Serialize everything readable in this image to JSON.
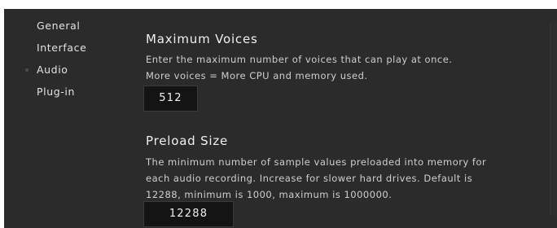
{
  "sidebar": {
    "items": [
      {
        "label": "General"
      },
      {
        "label": "Interface"
      },
      {
        "label": "Audio"
      },
      {
        "label": "Plug-in"
      }
    ]
  },
  "sections": {
    "max_voices": {
      "title": "Maximum Voices",
      "line1": "Enter the maximum number of voices that can play at once.",
      "line2": "More voices = More CPU and memory used.",
      "value": "512"
    },
    "preload": {
      "title": "Preload Size",
      "line1": "The minimum number of sample values preloaded into memory for",
      "line2": "each audio recording. Increase for slower hard drives. Default is",
      "line3": "12288, minimum is 1000, maximum is 1000000.",
      "value": "12288"
    }
  }
}
